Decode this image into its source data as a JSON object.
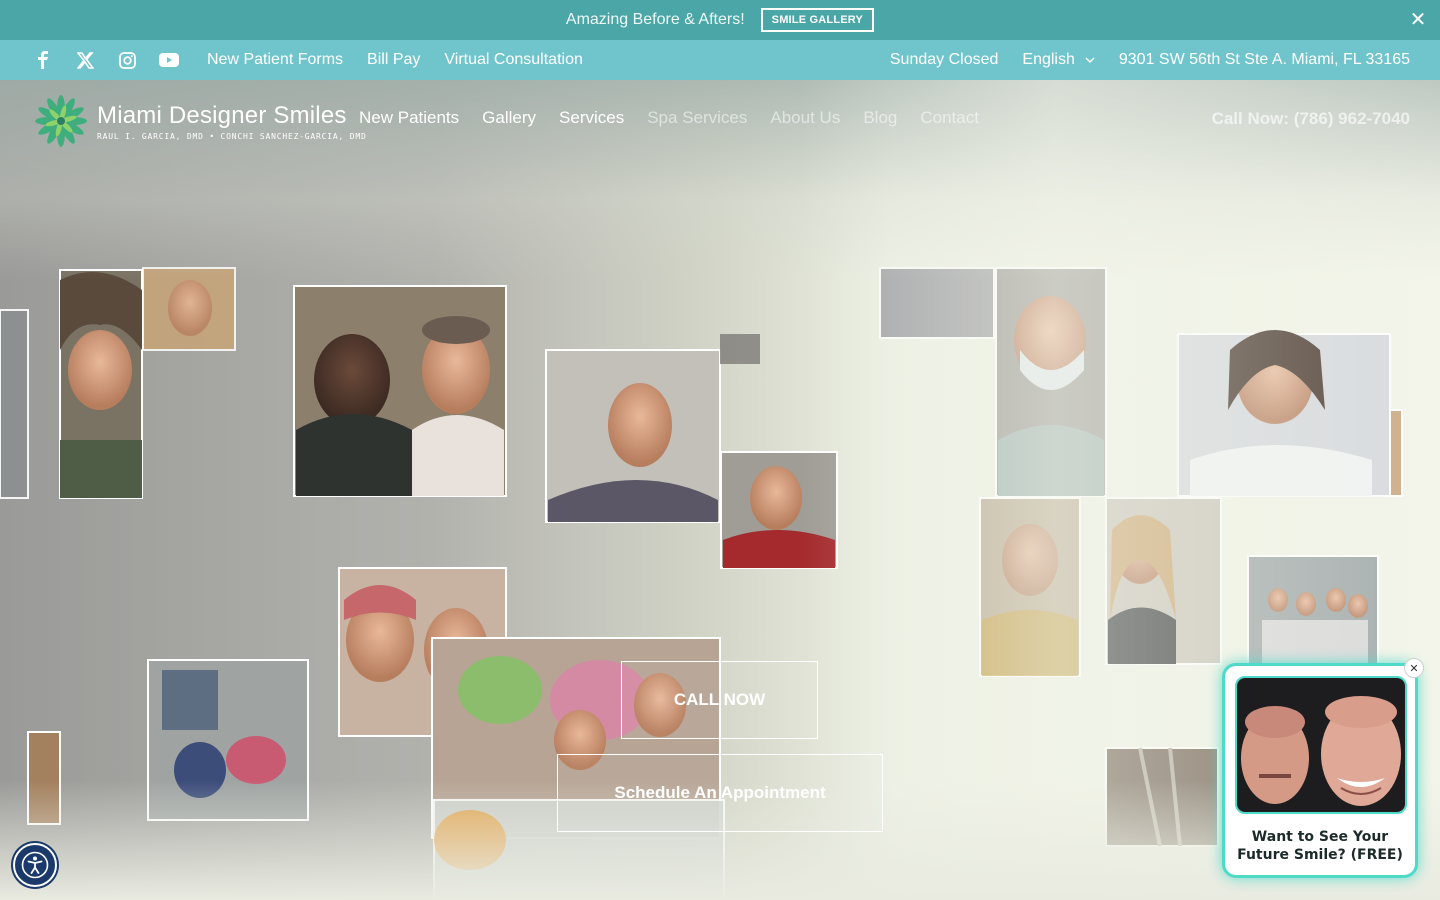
{
  "announcement": {
    "text": "Amazing Before & Afters!",
    "button_label": "SMILE GALLERY",
    "close_glyph": "✕"
  },
  "utility_bar": {
    "social_icons": [
      "facebook-icon",
      "x-twitter-icon",
      "instagram-icon",
      "youtube-icon"
    ],
    "links": [
      "New Patient Forms",
      "Bill Pay",
      "Virtual Consultation"
    ],
    "hours": "Sunday Closed",
    "language": "English",
    "address": "9301 SW 56th St Ste A. Miami, FL 33165"
  },
  "brand": {
    "name": "Miami Designer Smiles",
    "doctors": "RAUL I. GARCIA, DMD • CONCHI SANCHEZ-GARCIA, DMD"
  },
  "nav": {
    "items": [
      "New Patients",
      "Gallery",
      "Services",
      "Spa Services",
      "About Us",
      "Blog",
      "Contact"
    ],
    "call": "Call Now: (786) 962-7040"
  },
  "hero": {
    "cta_primary": "CALL NOW",
    "cta_secondary": "Schedule An Appointment"
  },
  "promo_widget": {
    "text_line1": "Want to See Your",
    "text_line2": "Future Smile? (FREE)",
    "close_glyph": "✕"
  },
  "colors": {
    "announcement_bg": "#4aa6a7",
    "utility_bg": "#70c5cc",
    "promo_glow": "#4fd9c9",
    "accessibility_bg": "#1b3a6b"
  },
  "accessibility": {
    "icon": "accessibility-icon"
  }
}
